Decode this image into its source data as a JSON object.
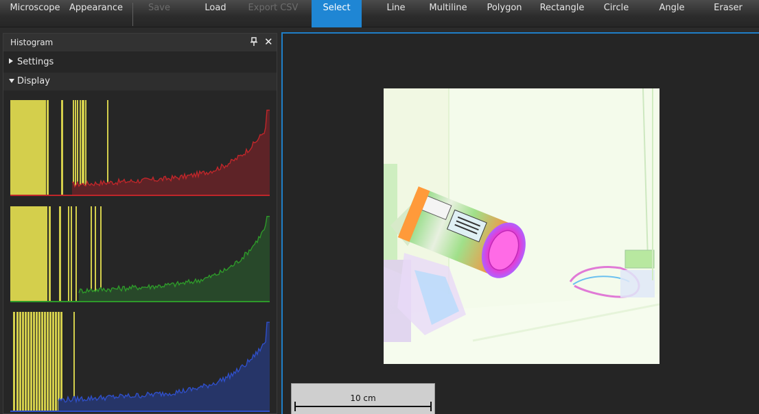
{
  "toolbar": {
    "items": [
      {
        "label": "Microscope",
        "state": "normal"
      },
      {
        "label": "Appearance",
        "state": "normal"
      },
      {
        "label": "Save",
        "state": "disabled"
      },
      {
        "label": "Load",
        "state": "normal"
      },
      {
        "label": "Export CSV",
        "state": "disabled"
      },
      {
        "label": "Select",
        "state": "active"
      },
      {
        "label": "Line",
        "state": "normal"
      },
      {
        "label": "Multiline",
        "state": "normal"
      },
      {
        "label": "Polygon",
        "state": "normal"
      },
      {
        "label": "Rectangle",
        "state": "normal"
      },
      {
        "label": "Circle",
        "state": "normal"
      },
      {
        "label": "Angle",
        "state": "normal"
      },
      {
        "label": "Eraser",
        "state": "normal"
      }
    ]
  },
  "histogram_panel": {
    "title": "Histogram",
    "pin_icon": "pin-icon",
    "close_icon": "close-icon",
    "close_glyph": "✕",
    "sections": [
      {
        "label": "Settings",
        "expanded": false
      },
      {
        "label": "Display",
        "expanded": true
      }
    ],
    "channels": [
      {
        "name": "red",
        "color": "#c0262a",
        "fill": "#5e2327"
      },
      {
        "name": "green",
        "color": "#2e9a2a",
        "fill": "#28482a"
      },
      {
        "name": "blue",
        "color": "#2f4fc8",
        "fill": "#263568"
      }
    ],
    "range_color": "#d4cf4c"
  },
  "viewer": {
    "accent": "#1f7fc8",
    "image": "inverted-camera-photo",
    "scale_bar": {
      "label": "10 cm"
    }
  },
  "colors": {
    "active_tab": "#1f86d4",
    "background": "#252525"
  }
}
